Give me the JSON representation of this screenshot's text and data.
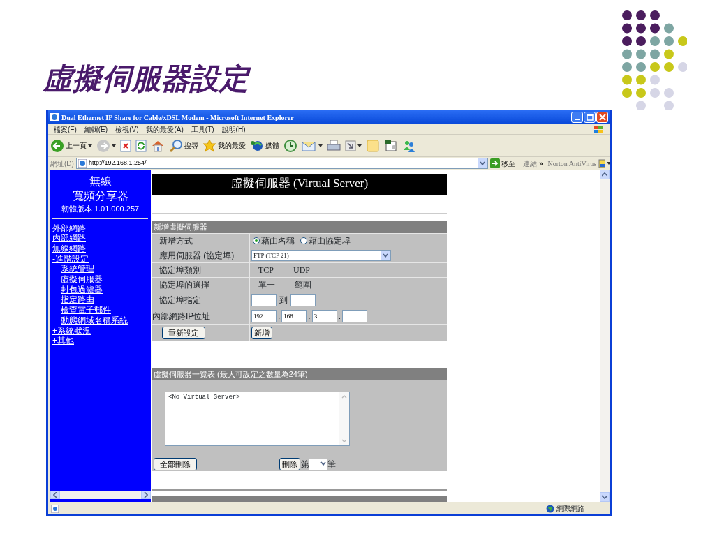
{
  "slide": {
    "title": "虛擬伺服器設定"
  },
  "window": {
    "title": "Dual Ethernet IP Share for Cable/xDSL Modem - Microsoft Internet Explorer"
  },
  "menu": [
    "檔案(F)",
    "編輯(E)",
    "檢視(V)",
    "我的最愛(A)",
    "工具(T)",
    "說明(H)"
  ],
  "toolbar": [
    {
      "kind": "back",
      "label": "上一頁",
      "dropdown": true
    },
    {
      "kind": "forward",
      "dropdown": true
    },
    {
      "kind": "stop"
    },
    {
      "kind": "refresh"
    },
    {
      "kind": "home"
    },
    {
      "kind": "search",
      "label": "搜尋"
    },
    {
      "kind": "favorites",
      "label": "我的最愛"
    },
    {
      "kind": "media",
      "label": "媒體"
    },
    {
      "kind": "history"
    },
    {
      "kind": "mail",
      "dropdown": true
    },
    {
      "kind": "print"
    },
    {
      "kind": "edit",
      "dropdown": true
    },
    {
      "kind": "note"
    },
    {
      "kind": "research"
    },
    {
      "kind": "messenger"
    }
  ],
  "address_bar": {
    "label": "網址(D)",
    "url": "http://192.168.1.254/",
    "go": "移至",
    "links": "連結",
    "chevron": "»",
    "addon": "Norton AntiVirus"
  },
  "sidebar": {
    "title": [
      "無線",
      "寬頻分享器"
    ],
    "version": "韌體版本 1.01.000.257",
    "items": [
      {
        "label": "外部網路"
      },
      {
        "label": "內部網路"
      },
      {
        "label": "無線網路"
      },
      {
        "label": "-進階設定",
        "children": [
          {
            "label": "系統管理"
          },
          {
            "label": "虛擬伺服器"
          },
          {
            "label": "封包過濾器"
          },
          {
            "label": "指定路由"
          },
          {
            "label": "檢查電子郵件"
          },
          {
            "label": "動態網域名稱系統"
          }
        ]
      },
      {
        "label": "+系統狀況"
      },
      {
        "label": "+其他"
      }
    ]
  },
  "page": {
    "heading": "虛擬伺服器 (Virtual Server)",
    "add_section": {
      "header": "新增虛擬伺服器",
      "rows": [
        {
          "kind": "radio",
          "label": "新增方式",
          "options": [
            {
              "label": "藉由名稱",
              "selected": true
            },
            {
              "label": "藉由協定埠",
              "selected": false
            }
          ]
        },
        {
          "kind": "select",
          "label": "應用伺服器 (協定埠)",
          "value": "FTP (TCP 21)"
        },
        {
          "kind": "text",
          "label": "協定埠類別",
          "values": [
            "TCP",
            "UDP"
          ]
        },
        {
          "kind": "text",
          "label": "協定埠的選擇",
          "values": [
            "單一",
            "範圍"
          ]
        },
        {
          "kind": "range",
          "label": "協定埠指定",
          "separator": "到"
        },
        {
          "kind": "ip",
          "label": "內部網路IP位址",
          "octets": [
            "192",
            "168",
            "3"
          ],
          "separator": "."
        },
        {
          "kind": "buttons",
          "buttons": [
            "重新設定",
            "新增"
          ]
        }
      ]
    },
    "list_section": {
      "header": "虛擬伺服器一覽表 (最大可設定之數量為24筆)",
      "items": [
        "<No Virtual Server>"
      ],
      "delete_all": "全部刪除",
      "delete": "刪除",
      "prefix": "第",
      "suffix": "筆"
    }
  },
  "status_bar": {
    "zone": "網際網路"
  }
}
